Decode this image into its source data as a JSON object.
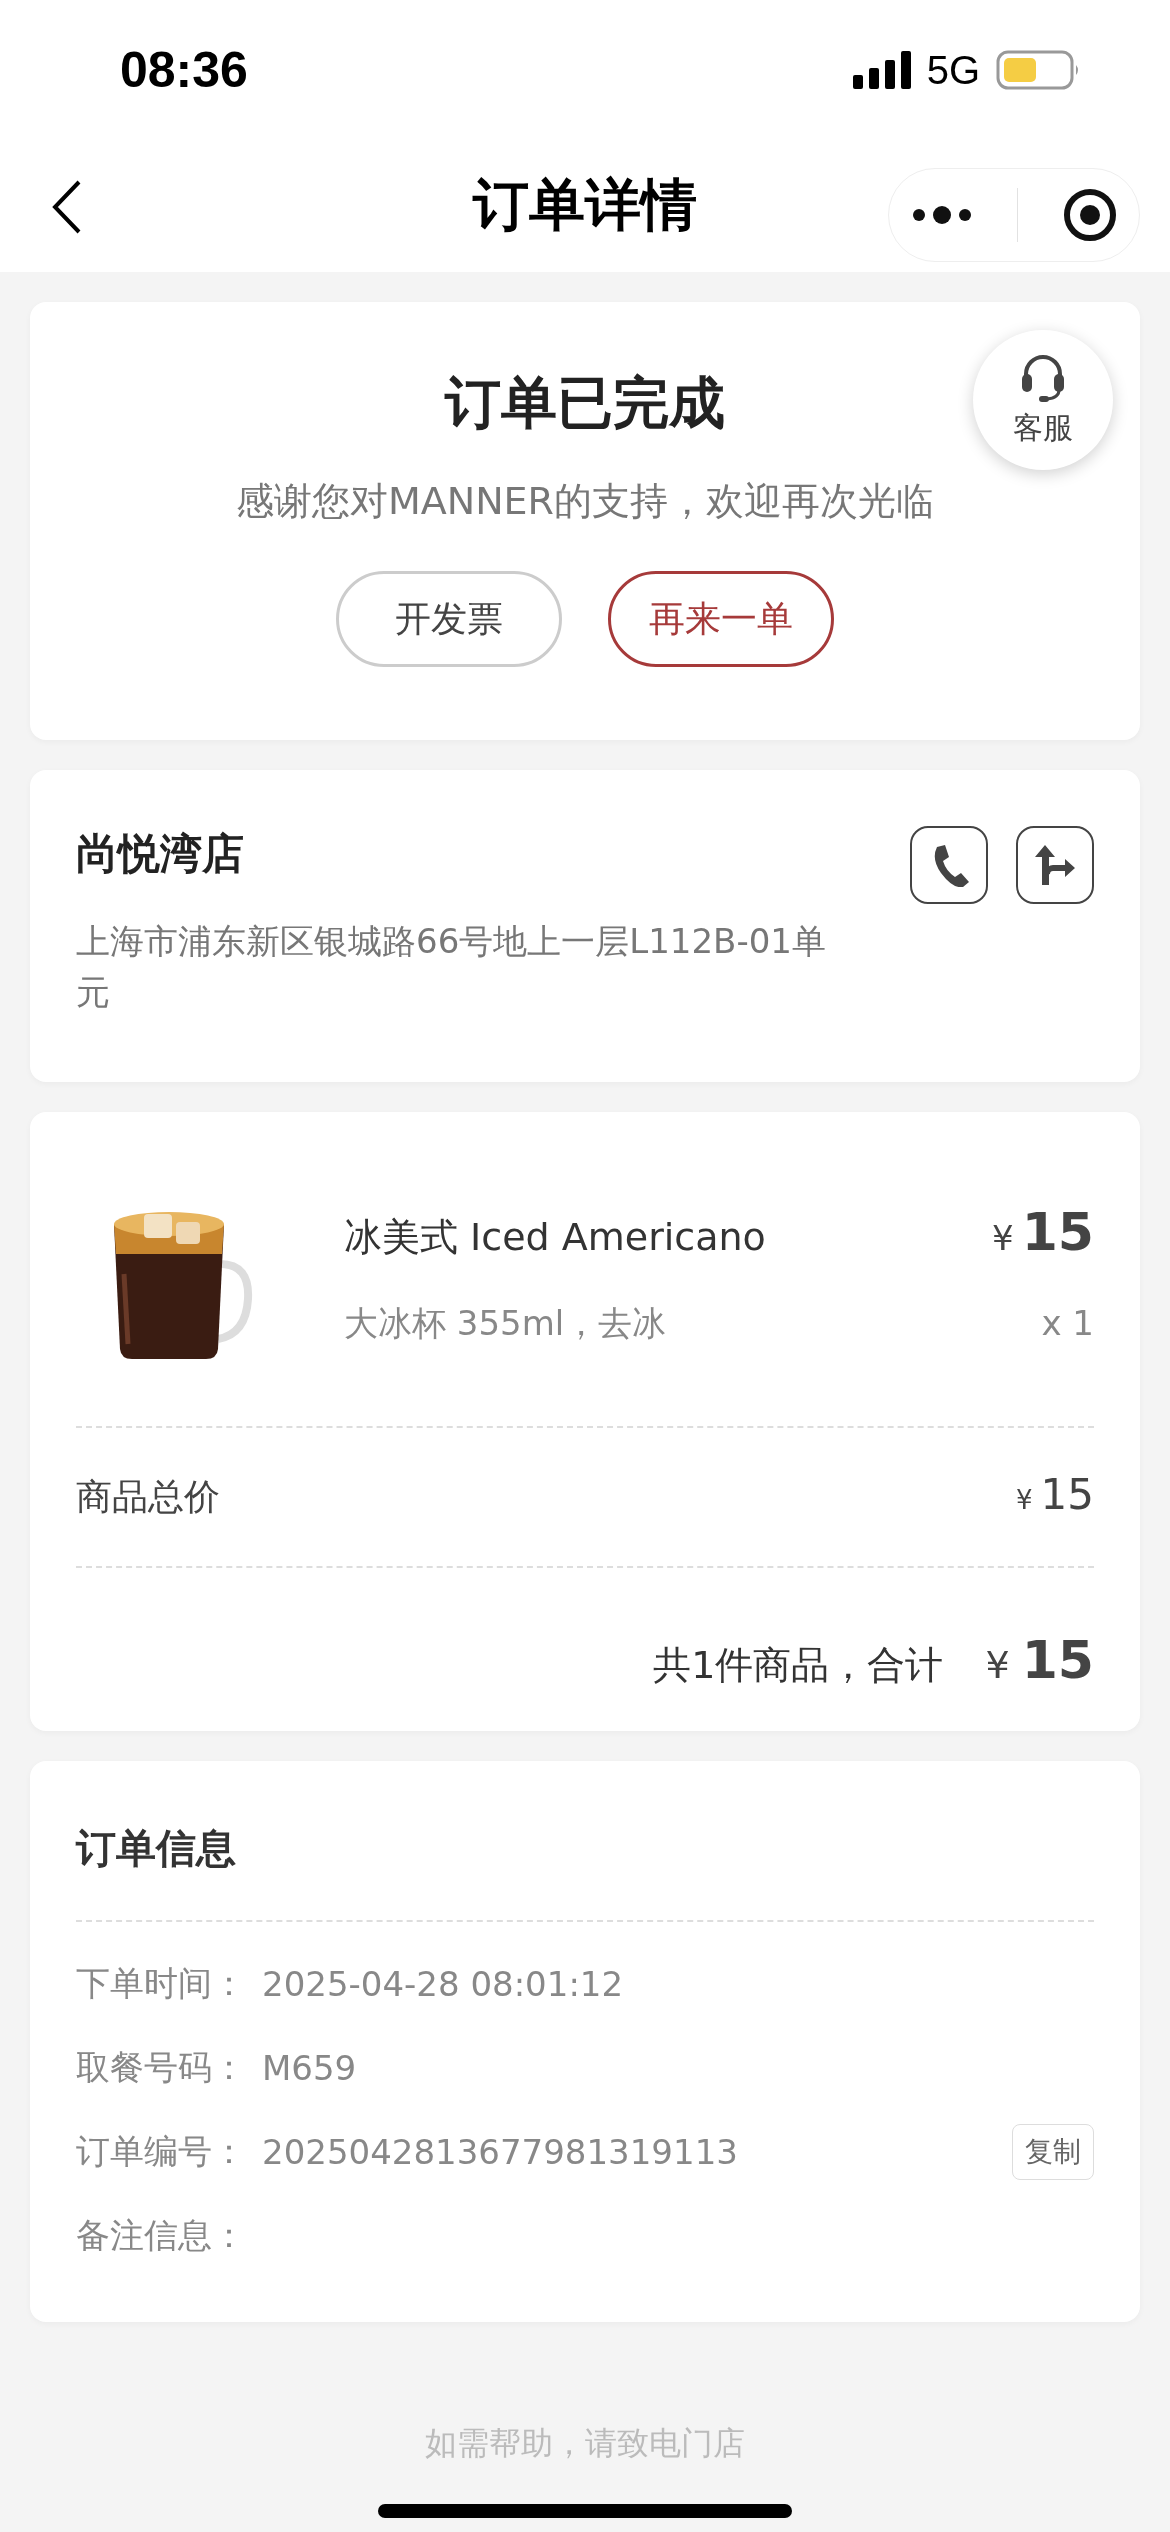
{
  "status_bar": {
    "time": "08:36",
    "network": "5G"
  },
  "nav": {
    "title": "订单详情"
  },
  "status_card": {
    "title": "订单已完成",
    "subtitle": "感谢您对MANNER的支持，欢迎再次光临",
    "support_label": "客服",
    "buttons": [
      {
        "label": "开发票",
        "kind": "outline"
      },
      {
        "label": "再来一单",
        "kind": "primary"
      }
    ]
  },
  "store": {
    "name": "尚悦湾店",
    "address": "上海市浦东新区银城路66号地上一层L112B-01单元"
  },
  "order": {
    "items": [
      {
        "name": "冰美式 Iced Americano",
        "spec": "大冰杯 355ml，去冰",
        "currency": "¥",
        "price": "15",
        "quantity": "x 1"
      }
    ],
    "subtotal": {
      "label": "商品总价",
      "currency": "¥",
      "value": "15"
    },
    "total": {
      "label": "共1件商品，合计",
      "currency": "¥",
      "value": "15"
    }
  },
  "order_info": {
    "title": "订单信息",
    "rows": [
      {
        "label": "下单时间：",
        "value": "2025-04-28 08:01:12"
      },
      {
        "label": "取餐号码：",
        "value": "M659"
      },
      {
        "label": "订单编号：",
        "value": "2025042813677981319113",
        "action": "复制"
      },
      {
        "label": "备注信息："
      }
    ]
  },
  "footer": "如需帮助，请致电门店"
}
